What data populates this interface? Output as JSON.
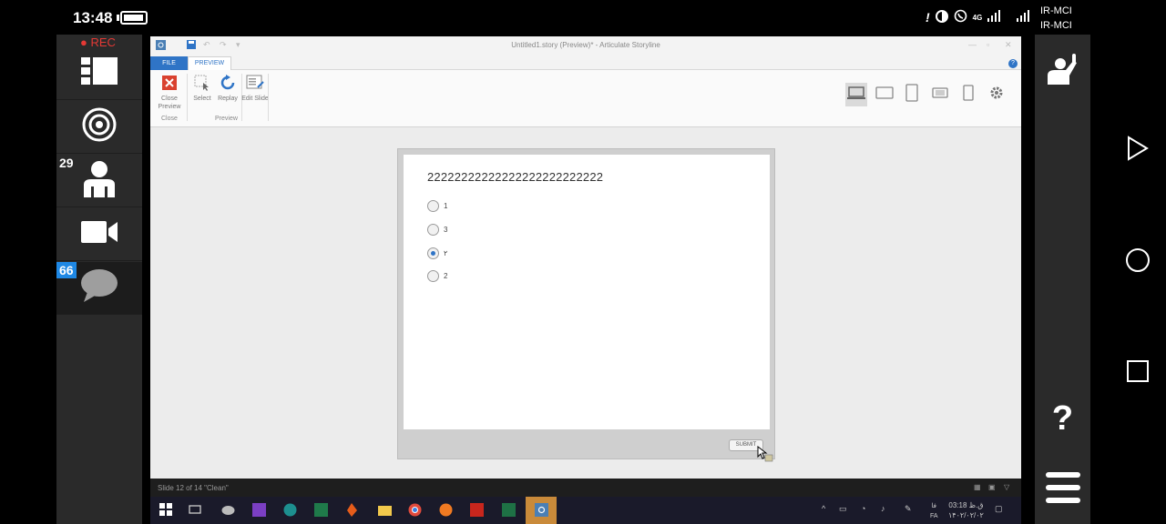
{
  "status_bar": {
    "time": "13:48",
    "carrier_1": "IR-MCI",
    "carrier_2": "IR-MCI",
    "network": "4G",
    "icons": [
      "alert-icon",
      "data-saver-icon",
      "whatsapp-icon",
      "signal-icon",
      "signal-icon"
    ]
  },
  "left_panel": {
    "rec_label": "REC",
    "participants_count": "29",
    "chat_count": "66",
    "items": [
      "layout-icon",
      "target-icon",
      "person-icon",
      "camera-icon",
      "chat-icon"
    ]
  },
  "right_panel": {
    "items": [
      "raise-hand-icon",
      "help-icon",
      "menu-icon"
    ],
    "help_label": "?"
  },
  "nav": {
    "items": [
      "back-triangle-icon",
      "home-circle-icon",
      "recents-square-icon"
    ]
  },
  "storyline": {
    "window_title": "Untitled1.story (Preview)* - Articulate Storyline",
    "tabs": {
      "file": "FILE",
      "preview": "PREVIEW"
    },
    "help": "?",
    "ribbon": {
      "close_preview": "Close Preview",
      "select": "Select",
      "replay": "Replay",
      "edit_slide": "Edit Slide",
      "group_close": "Close",
      "group_preview": "Preview"
    },
    "device_buttons": [
      "desktop-icon",
      "tablet-landscape-icon",
      "tablet-portrait-icon",
      "phone-landscape-icon",
      "phone-portrait-icon",
      "settings-icon"
    ],
    "slide": {
      "question": "22222222222222222222222222",
      "options": [
        {
          "label": "1",
          "checked": false
        },
        {
          "label": "3",
          "checked": false
        },
        {
          "label": "٢",
          "checked": true
        },
        {
          "label": "2",
          "checked": false
        }
      ],
      "submit_label": "SUBMIT"
    },
    "status_text": "Slide 12 of 14   \"Clean\""
  },
  "taskbar": {
    "clock_time": "03:18 ق.ظ",
    "clock_date": "۱۴۰۲/۰۲/۰۲",
    "lang": "FA",
    "lang_fa": "فا"
  }
}
